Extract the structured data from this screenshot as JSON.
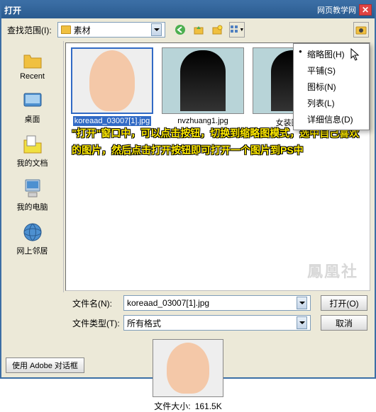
{
  "titlebar": {
    "title": "打开",
    "right_text": "网页教学网"
  },
  "toolbar": {
    "look_label": "查找范围(I):",
    "look_value": "素材"
  },
  "sidebar": {
    "items": [
      {
        "label": "Recent"
      },
      {
        "label": "桌面"
      },
      {
        "label": "我的文档"
      },
      {
        "label": "我的电脑"
      },
      {
        "label": "网上邻居"
      }
    ]
  },
  "view_menu": {
    "items": [
      {
        "label": "缩略图(H)",
        "selected": true
      },
      {
        "label": "平铺(S)"
      },
      {
        "label": "图标(N)"
      },
      {
        "label": "列表(L)"
      },
      {
        "label": "详细信息(D)"
      }
    ]
  },
  "files": [
    {
      "name": "koreaad_03007[1].jpg",
      "selected": true
    },
    {
      "name": "nvzhuang1.jpg"
    },
    {
      "name": "女装图.jpg"
    }
  ],
  "help_text": "\"打开\"窗口中，可以点击按钮，切换到缩略图模式，选中自己喜欢的图片，然后点击打开按钮即可打开一个图片到PS中",
  "form": {
    "filename_label": "文件名(N):",
    "filename_value": "koreaad_03007[1].jpg",
    "filetype_label": "文件类型(T):",
    "filetype_value": "所有格式",
    "open_btn": "打开(O)",
    "cancel_btn": "取消"
  },
  "preview": {
    "label_prefix": "文件大小:",
    "size": "161.5K"
  },
  "footer": {
    "adobe_btn": "使用 Adobe 对话框"
  },
  "watermark": "鳳凰社"
}
